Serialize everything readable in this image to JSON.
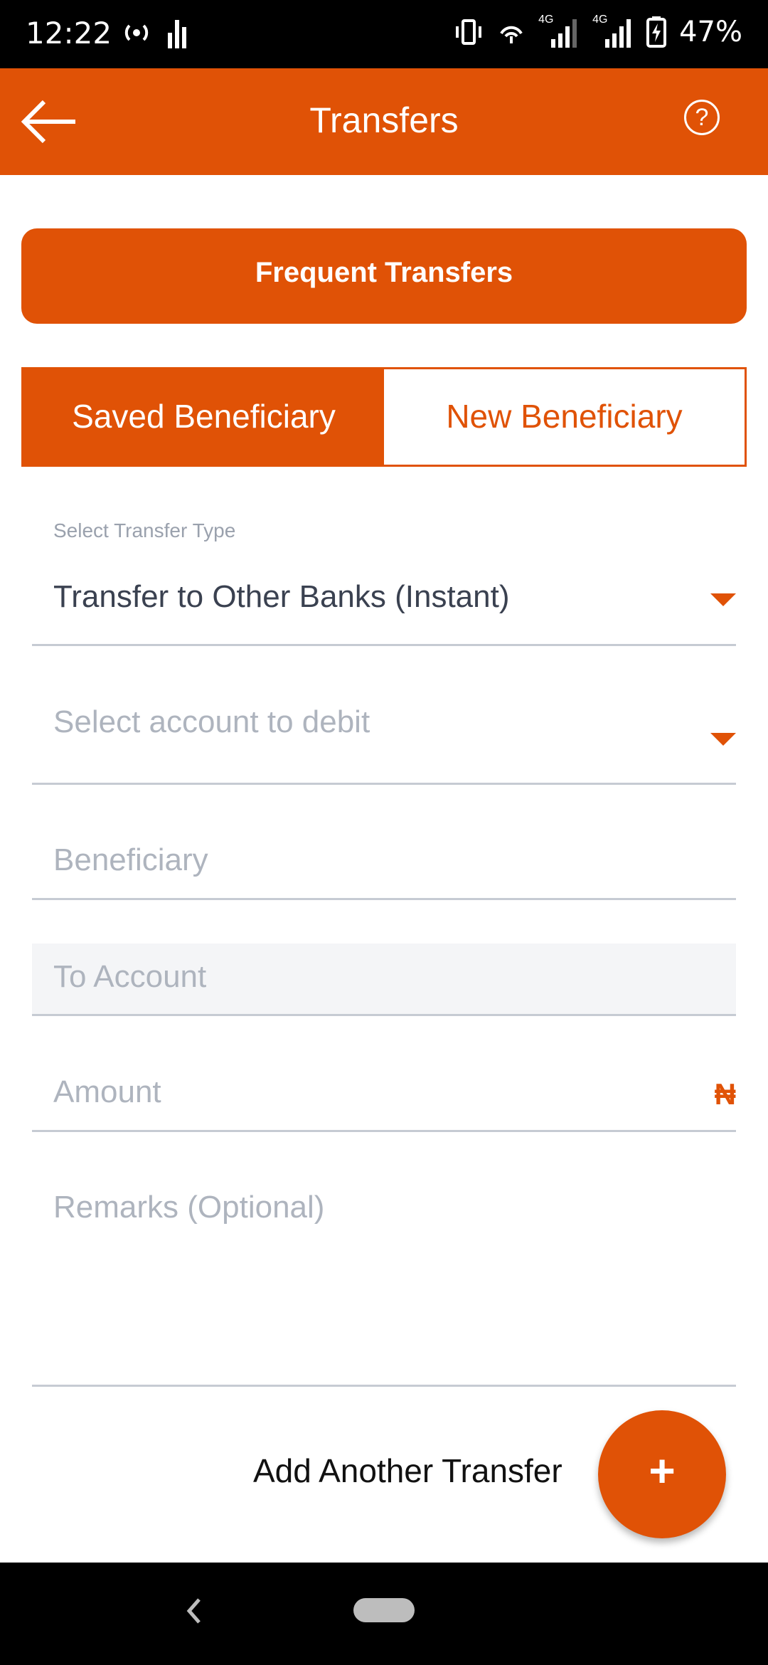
{
  "status_bar": {
    "time": "12:22",
    "battery": "47%",
    "net_1": "4G",
    "net_2": "4G"
  },
  "app_bar": {
    "title": "Transfers",
    "help_glyph": "?"
  },
  "frequent_transfers_label": "Frequent Transfers",
  "tabs": {
    "saved": "Saved Beneficiary",
    "new": "New Beneficiary"
  },
  "form": {
    "transfer_type_label": "Select Transfer Type",
    "transfer_type_value": "Transfer to Other Banks (Instant)",
    "debit_account_placeholder": "Select account to debit",
    "beneficiary_placeholder": "Beneficiary",
    "to_account_placeholder": "To Account",
    "amount_placeholder": "Amount",
    "currency_symbol": "₦",
    "remarks_placeholder": "Remarks (Optional)"
  },
  "add_another": {
    "label": "Add Another Transfer",
    "fab_glyph": "+"
  },
  "colors": {
    "brand_orange": "#e05206",
    "placeholder_gray": "#aeb4be",
    "text_dark": "#3a4150"
  },
  "icons": {
    "back": "arrow-left-icon",
    "help": "help-circle-icon",
    "dropdown": "caret-down-icon",
    "add": "plus-icon"
  }
}
